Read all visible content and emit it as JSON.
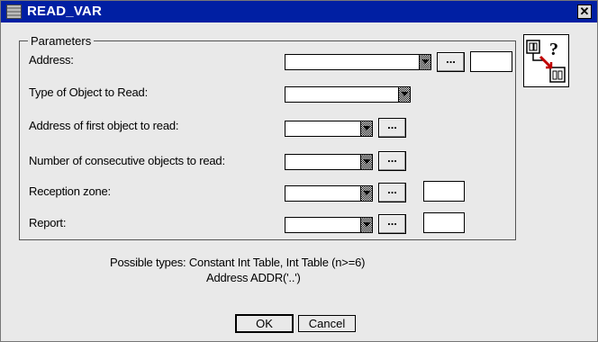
{
  "window": {
    "title": "READ_VAR",
    "close_glyph": "✕"
  },
  "parameters": {
    "legend": "Parameters",
    "rows": [
      {
        "label": "Address:",
        "value": "",
        "extra_value": ""
      },
      {
        "label": "Type of Object to Read:",
        "value": ""
      },
      {
        "label": "Address of first object to read:",
        "value": ""
      },
      {
        "label": "Number of consecutive objects to read:",
        "value": ""
      },
      {
        "label": "Reception zone:",
        "value": "",
        "extra_value": ""
      },
      {
        "label": "Report:",
        "value": "",
        "extra_value": ""
      }
    ],
    "browse_label": "..."
  },
  "info": {
    "line1": "Possible types: Constant Int Table, Int Table (n>=6)",
    "line2": "Address ADDR('..')"
  },
  "buttons": {
    "ok": "OK",
    "cancel": "Cancel"
  },
  "icons": {
    "title": "function-block-icon",
    "side": "help-variable-icon"
  }
}
